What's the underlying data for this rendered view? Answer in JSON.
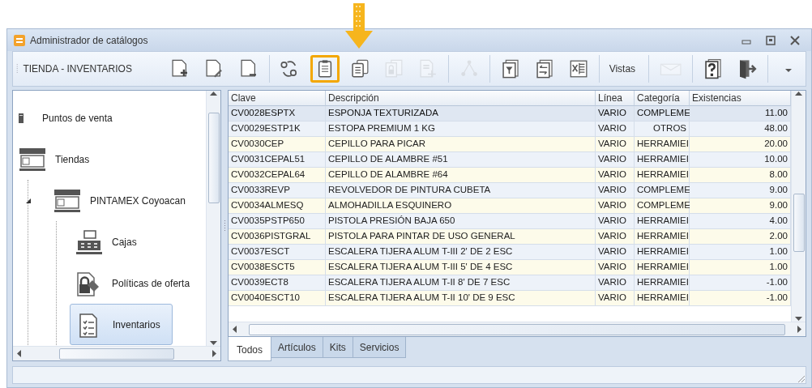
{
  "window": {
    "title": "Administrador de catálogos"
  },
  "toolbar": {
    "title": "TIENDA - INVENTARIOS",
    "items": [
      {
        "kind": "new-doc",
        "disabled": false,
        "highlighted": false
      },
      {
        "kind": "edit-doc",
        "disabled": false,
        "highlighted": false
      },
      {
        "kind": "remove-doc",
        "disabled": false,
        "highlighted": false
      },
      {
        "kind": "separator"
      },
      {
        "kind": "exchange",
        "disabled": false,
        "highlighted": false
      },
      {
        "kind": "clipboard",
        "disabled": false,
        "highlighted": true
      },
      {
        "kind": "clipboards",
        "disabled": false,
        "highlighted": false
      },
      {
        "kind": "lock-doc",
        "disabled": true,
        "highlighted": false
      },
      {
        "kind": "scale-doc",
        "disabled": true,
        "highlighted": false
      },
      {
        "kind": "separator"
      },
      {
        "kind": "money-tree",
        "disabled": true,
        "highlighted": false
      },
      {
        "kind": "separator"
      },
      {
        "kind": "filter",
        "disabled": false,
        "highlighted": false
      },
      {
        "kind": "transfer",
        "disabled": false,
        "highlighted": false
      },
      {
        "kind": "spreadsheet",
        "disabled": false,
        "highlighted": false
      },
      {
        "kind": "separator"
      },
      {
        "kind": "dropdown",
        "label": "Vistas",
        "disabled": false,
        "highlighted": false
      },
      {
        "kind": "separator"
      },
      {
        "kind": "mail",
        "disabled": true,
        "highlighted": false
      },
      {
        "kind": "separator"
      },
      {
        "kind": "help",
        "disabled": false,
        "highlighted": false
      },
      {
        "kind": "exit",
        "disabled": false,
        "highlighted": false
      },
      {
        "kind": "separator"
      },
      {
        "kind": "overflow",
        "disabled": false,
        "highlighted": false
      }
    ]
  },
  "tree": [
    {
      "label": "Puntos de venta",
      "kind": "cabinet",
      "selected": false
    },
    {
      "label": "Tiendas",
      "kind": "store",
      "selected": false,
      "children": [
        {
          "label": "PINTAMEX Coyoacan",
          "kind": "store",
          "selected": false,
          "expanded": true,
          "children": [
            {
              "label": "Cajas",
              "kind": "register",
              "selected": false
            },
            {
              "label": "Políticas de oferta",
              "kind": "lock-tag",
              "selected": false
            },
            {
              "label": "Inventarios",
              "kind": "checklist",
              "selected": true
            }
          ]
        }
      ]
    }
  ],
  "table": {
    "columns": [
      "Clave",
      "Descripción",
      "Línea",
      "Categoría",
      "Existencias"
    ],
    "rows": [
      {
        "cells": [
          "CV0028ESPTX",
          "ESPONJA TEXTURIZADA",
          "VARIO",
          "COMPLEME",
          "11.00"
        ],
        "selected": true
      },
      {
        "cells": [
          "CV0029ESTP1K",
          "ESTOPA PREMIUM 1 KG",
          "VARIO",
          "OTROS",
          "48.00"
        ],
        "selected": false
      },
      {
        "cells": [
          "CV0030CEP",
          "CEPILLO PARA PICAR",
          "VARIO",
          "HERRAMIEI",
          "20.00"
        ],
        "selected": false
      },
      {
        "cells": [
          "CV0031CEPAL51",
          "CEPILLO DE ALAMBRE #51",
          "VARIO",
          "HERRAMIEI",
          "10.00"
        ],
        "selected": false
      },
      {
        "cells": [
          "CV0032CEPAL64",
          "CEPILLO DE ALAMBRE #64",
          "VARIO",
          "HERRAMIEI",
          "8.00"
        ],
        "selected": false
      },
      {
        "cells": [
          "CV0033REVP",
          "REVOLVEDOR DE PINTURA CUBETA",
          "VARIO",
          "COMPLEME",
          "9.00"
        ],
        "selected": false
      },
      {
        "cells": [
          "CV0034ALMESQ",
          "ALMOHADILLA ESQUINERO",
          "VARIO",
          "COMPLEME",
          "9.00"
        ],
        "selected": false
      },
      {
        "cells": [
          "CV0035PSTP650",
          "PISTOLA PRESIÓN BAJA 650",
          "VARIO",
          "HERRAMIEI",
          "4.00"
        ],
        "selected": false
      },
      {
        "cells": [
          "CV0036PISTGRAL",
          "PISTOLA PARA PINTAR DE USO GENERAL",
          "VARIO",
          "HERRAMIEI",
          "2.00"
        ],
        "selected": false
      },
      {
        "cells": [
          "CV0037ESCT",
          "ESCALERA TIJERA ALUM T-III 2' DE 2 ESC",
          "VARIO",
          "HERRAMIEI",
          "1.00"
        ],
        "selected": false
      },
      {
        "cells": [
          "CV0038ESCT5",
          "ESCALERA TIJERA ALUM T-III 5' DE 4 ESC",
          "VARIO",
          "HERRAMIEI",
          "1.00"
        ],
        "selected": false
      },
      {
        "cells": [
          "CV0039ECT8",
          "ESCALERA TIJERA ALUM T-II 8' DE 7 ESC",
          "VARIO",
          "HERRAMIEI",
          "-1.00"
        ],
        "selected": false
      },
      {
        "cells": [
          "CV0040ESCT10",
          "ESCALERA TIJERA ALUM T-II 10' DE 9 ESC",
          "VARIO",
          "HERRAMIEI",
          "-1.00"
        ],
        "selected": false
      }
    ]
  },
  "grid_tabs": [
    {
      "label": "Todos",
      "selected": true
    },
    {
      "label": "Artículos",
      "selected": false
    },
    {
      "label": "Kits",
      "selected": false
    },
    {
      "label": "Servicios",
      "selected": false
    }
  ]
}
